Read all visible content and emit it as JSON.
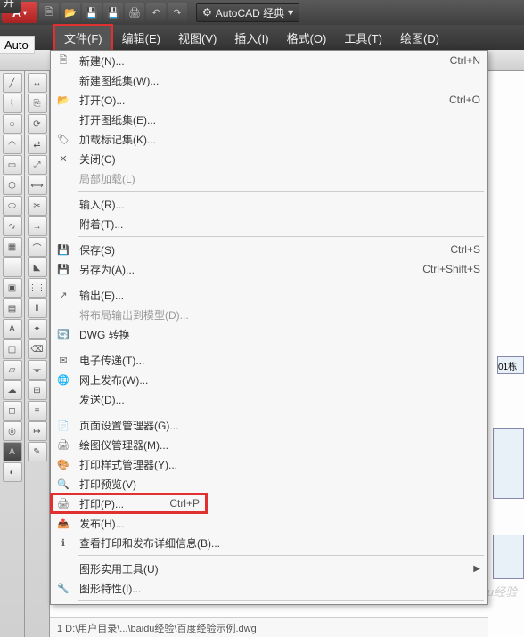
{
  "toolbar": {
    "app_logo": "A",
    "workspace_label": "AutoCAD 经典",
    "gear_icon": "⚙"
  },
  "menubar": {
    "items": [
      {
        "label": "文件(F)",
        "active": true
      },
      {
        "label": "编辑(E)"
      },
      {
        "label": "视图(V)"
      },
      {
        "label": "插入(I)"
      },
      {
        "label": "格式(O)"
      },
      {
        "label": "工具(T)"
      },
      {
        "label": "绘图(D)"
      }
    ]
  },
  "tabs": {
    "open": "开",
    "auto": "Auto"
  },
  "dropdown": {
    "items": [
      {
        "icon": "🗎",
        "label": "新建(N)...",
        "shortcut": "Ctrl+N"
      },
      {
        "icon": "",
        "label": "新建图纸集(W)..."
      },
      {
        "icon": "📂",
        "label": "打开(O)...",
        "shortcut": "Ctrl+O"
      },
      {
        "icon": "",
        "label": "打开图纸集(E)..."
      },
      {
        "icon": "🏷",
        "label": "加载标记集(K)..."
      },
      {
        "icon": "✕",
        "label": "关闭(C)"
      },
      {
        "icon": "",
        "label": "局部加载(L)",
        "disabled": true
      },
      {
        "sep": true
      },
      {
        "icon": "",
        "label": "输入(R)..."
      },
      {
        "icon": "",
        "label": "附着(T)..."
      },
      {
        "sep": true
      },
      {
        "icon": "💾",
        "label": "保存(S)",
        "shortcut": "Ctrl+S"
      },
      {
        "icon": "💾",
        "label": "另存为(A)...",
        "shortcut": "Ctrl+Shift+S"
      },
      {
        "sep": true
      },
      {
        "icon": "↗",
        "label": "输出(E)..."
      },
      {
        "icon": "",
        "label": "将布局输出到模型(D)...",
        "disabled": true
      },
      {
        "icon": "🔄",
        "label": "DWG 转换"
      },
      {
        "sep": true
      },
      {
        "icon": "✉",
        "label": "电子传递(T)..."
      },
      {
        "icon": "🌐",
        "label": "网上发布(W)..."
      },
      {
        "icon": "",
        "label": "发送(D)..."
      },
      {
        "sep": true
      },
      {
        "icon": "📄",
        "label": "页面设置管理器(G)..."
      },
      {
        "icon": "🖨",
        "label": "绘图仪管理器(M)..."
      },
      {
        "icon": "🎨",
        "label": "打印样式管理器(Y)..."
      },
      {
        "icon": "🔍",
        "label": "打印预览(V)"
      },
      {
        "icon": "🖨",
        "label": "打印(P)...",
        "shortcut": "Ctrl+P",
        "highlight": true
      },
      {
        "icon": "📤",
        "label": "发布(H)..."
      },
      {
        "icon": "ℹ",
        "label": "查看打印和发布详细信息(B)..."
      },
      {
        "sep": true
      },
      {
        "icon": "",
        "label": "图形实用工具(U)",
        "submenu": true
      },
      {
        "icon": "🔧",
        "label": "图形特性(I)..."
      },
      {
        "sep": true
      }
    ],
    "recent": "1 D:\\用户目录\\...\\baidu经验\\百度经验示例.dwg"
  },
  "canvas": {
    "text_fragment": "01栋"
  },
  "watermark": "Baidu经验"
}
